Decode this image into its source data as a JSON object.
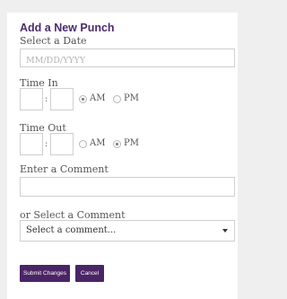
{
  "form": {
    "title": "Add a New Punch",
    "date_label": "Select a Date",
    "date_placeholder": "MM/DD/YYYY",
    "time_in_label": "Time In",
    "time_out_label": "Time Out",
    "time_in_hour": "",
    "time_in_minute": "",
    "time_out_hour": "",
    "time_out_minute": "",
    "colon": ":",
    "am_label": "AM",
    "pm_label": "PM",
    "time_in_meridiem": "AM",
    "time_out_meridiem": "PM",
    "comment_label": "Enter a Comment",
    "comment_value": "",
    "select_comment_label": "or Select a Comment",
    "select_comment_value": "Select a comment...",
    "submit_label": "Submit Changes",
    "cancel_label": "Cancel"
  },
  "colors": {
    "accent": "#4a2566",
    "title": "#4a2c6b",
    "background": "#f0eff0"
  },
  "icons": {
    "dropdown": "chevron-down-icon"
  }
}
